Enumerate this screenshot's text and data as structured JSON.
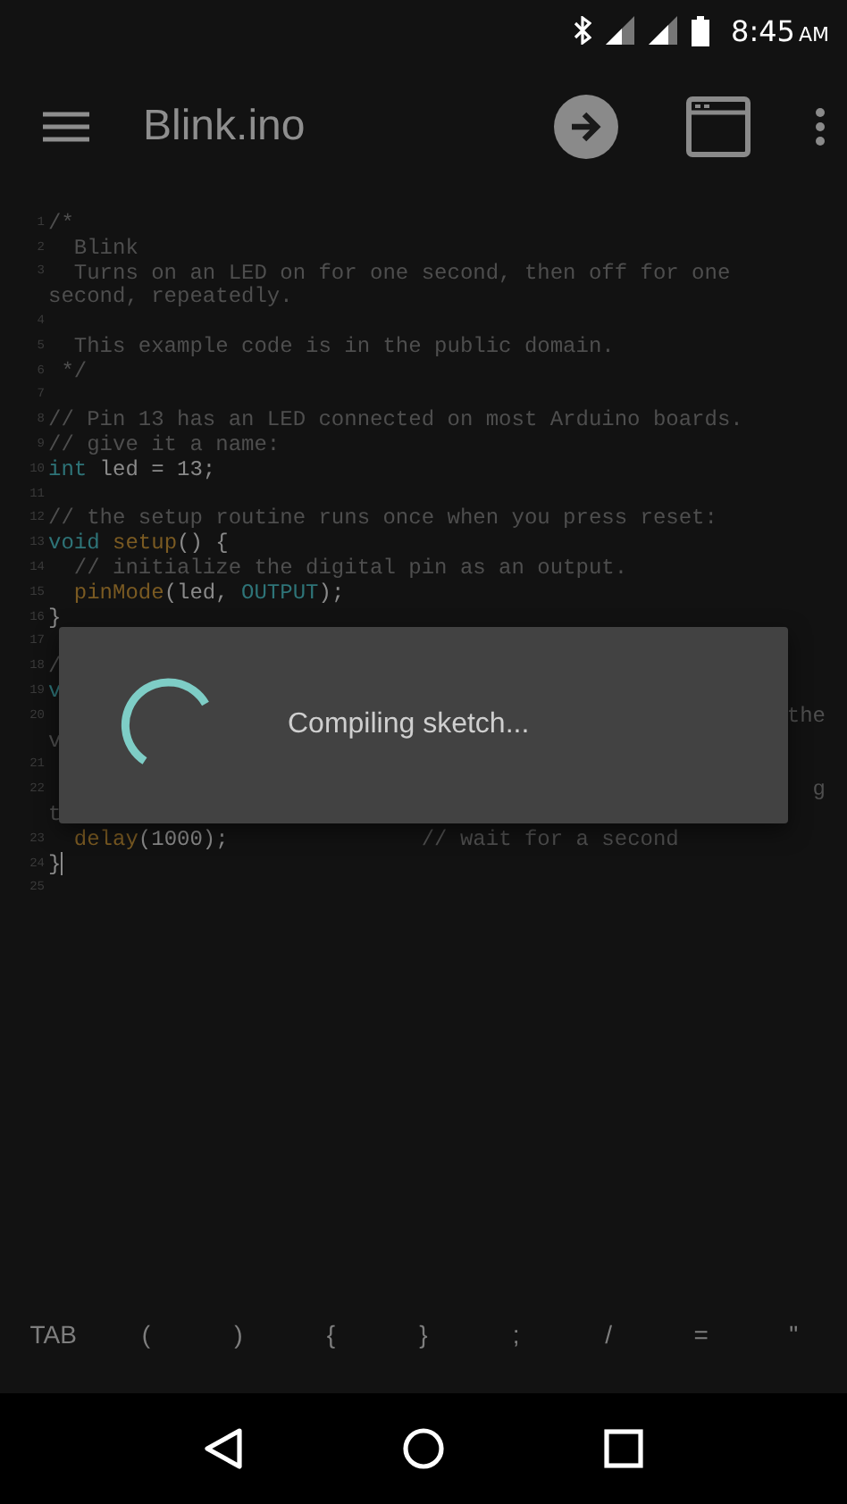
{
  "status_bar": {
    "time": "8:45",
    "meridiem": "AM"
  },
  "toolbar": {
    "title": "Blink.ino"
  },
  "editor": {
    "lines": [
      {
        "number": "1",
        "segments": [
          {
            "kind": "comment",
            "text": "/*"
          }
        ]
      },
      {
        "number": "2",
        "segments": [
          {
            "kind": "comment",
            "text": "  Blink"
          }
        ]
      },
      {
        "number": "3",
        "segments": [
          {
            "kind": "comment",
            "text": "  Turns on an LED on for one second, then off for one"
          }
        ],
        "wrap": [
          {
            "kind": "comment",
            "text": "second, repeatedly."
          }
        ]
      },
      {
        "number": "4"
      },
      {
        "number": "5",
        "segments": [
          {
            "kind": "comment",
            "text": "  This example code is in the public domain."
          }
        ]
      },
      {
        "number": "6",
        "segments": [
          {
            "kind": "comment",
            "text": " */"
          }
        ]
      },
      {
        "number": "7"
      },
      {
        "number": "8",
        "segments": [
          {
            "kind": "comment",
            "text": "// Pin 13 has an LED connected on most Arduino boards."
          }
        ]
      },
      {
        "number": "9",
        "segments": [
          {
            "kind": "comment",
            "text": "// give it a name:"
          }
        ]
      },
      {
        "number": "10",
        "segments": [
          {
            "kind": "keyword",
            "text": "int"
          },
          {
            "kind": "plain",
            "text": " led = 13;"
          }
        ]
      },
      {
        "number": "11"
      },
      {
        "number": "12",
        "segments": [
          {
            "kind": "comment",
            "text": "// the setup routine runs once when you press reset:"
          }
        ]
      },
      {
        "number": "13",
        "segments": [
          {
            "kind": "keyword",
            "text": "void"
          },
          {
            "kind": "function",
            "text": " setup"
          },
          {
            "kind": "plain",
            "text": "() {"
          }
        ]
      },
      {
        "number": "14",
        "segments": [
          {
            "kind": "comment",
            "text": "  // initialize the digital pin as an output."
          }
        ]
      },
      {
        "number": "15",
        "segments": [
          {
            "kind": "function",
            "text": "  pinMode"
          },
          {
            "kind": "plain",
            "text": "(led, "
          },
          {
            "kind": "keyword",
            "text": "OUTPUT"
          },
          {
            "kind": "plain",
            "text": ");"
          }
        ]
      },
      {
        "number": "16",
        "segments": [
          {
            "kind": "plain",
            "text": "}"
          }
        ]
      },
      {
        "number": "17"
      },
      {
        "number": "18",
        "segments": [
          {
            "kind": "comment",
            "text": "/"
          }
        ]
      },
      {
        "number": "19",
        "segments": [
          {
            "kind": "keyword",
            "text": "v"
          }
        ]
      },
      {
        "number": "20",
        "tail": "the",
        "wrap": [
          {
            "kind": "comment",
            "text": "v"
          }
        ]
      },
      {
        "number": "21"
      },
      {
        "number": "22",
        "tail": "g",
        "wrap": [
          {
            "kind": "comment",
            "text": "t"
          }
        ]
      },
      {
        "number": "23",
        "segments": [
          {
            "kind": "function",
            "text": "  delay"
          },
          {
            "kind": "plain",
            "text": "(1000);               "
          },
          {
            "kind": "comment",
            "text": "// wait for a second"
          }
        ]
      },
      {
        "number": "24",
        "segments": [
          {
            "kind": "plain",
            "text": "}"
          }
        ],
        "cursor": true
      },
      {
        "number": "25"
      }
    ]
  },
  "dialog": {
    "message": "Compiling sketch..."
  },
  "keys": [
    "TAB",
    "(",
    ")",
    "{",
    "}",
    ";",
    "/",
    "=",
    "\""
  ]
}
